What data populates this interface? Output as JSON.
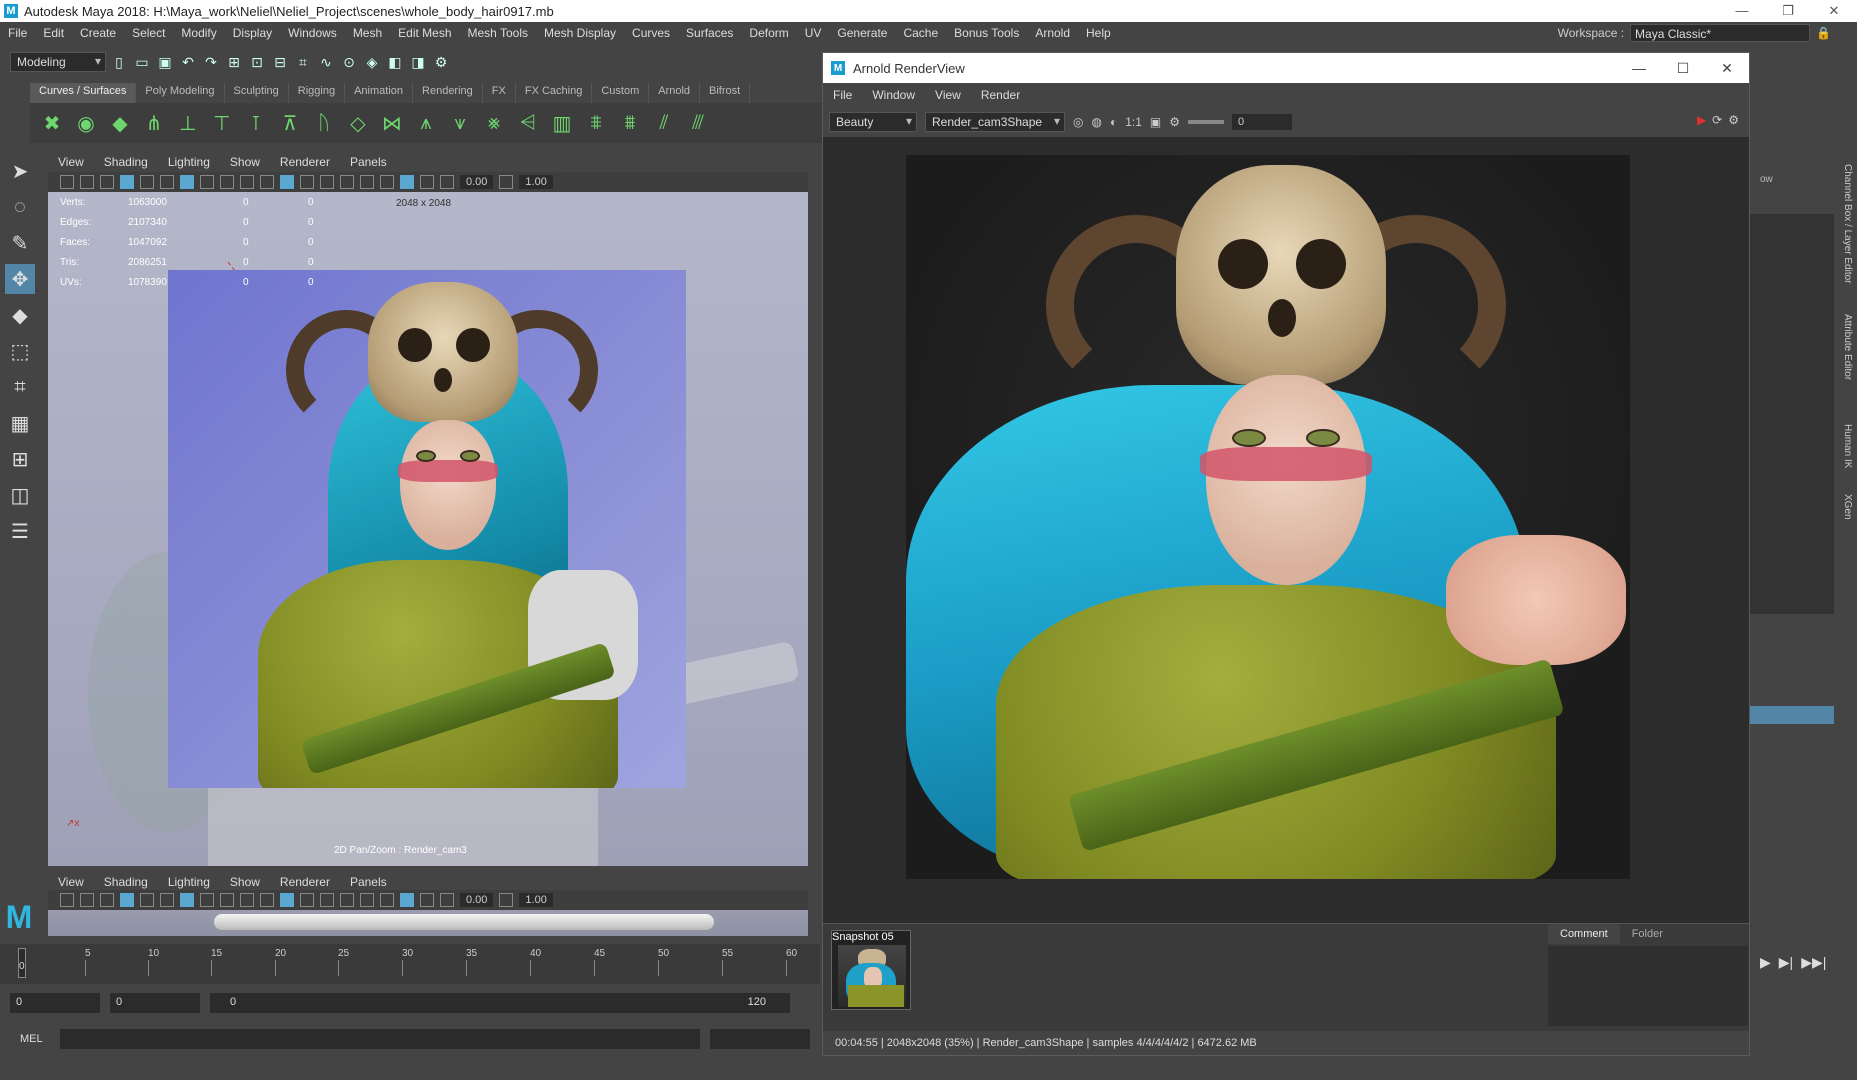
{
  "window": {
    "title": "Autodesk Maya 2018: H:\\Maya_work\\Neliel\\Neliel_Project\\scenes\\whole_body_hair0917.mb",
    "logo": "M"
  },
  "menubar": [
    "File",
    "Edit",
    "Create",
    "Select",
    "Modify",
    "Display",
    "Windows",
    "Mesh",
    "Edit Mesh",
    "Mesh Tools",
    "Mesh Display",
    "Curves",
    "Surfaces",
    "Deform",
    "UV",
    "Generate",
    "Cache",
    "Bonus Tools",
    "Arnold",
    "Help"
  ],
  "workspace": {
    "label": "Workspace :",
    "value": "Maya Classic*"
  },
  "statusline": {
    "mode": "Modeling"
  },
  "shelf_tabs": [
    "Curves / Surfaces",
    "Poly Modeling",
    "Sculpting",
    "Rigging",
    "Animation",
    "Rendering",
    "FX",
    "FX Caching",
    "Custom",
    "Arnold",
    "Bifrost"
  ],
  "viewport": {
    "menu": [
      "View",
      "Shading",
      "Lighting",
      "Show",
      "Renderer",
      "Panels"
    ],
    "fields": {
      "a": "0.00",
      "b": "1.00"
    },
    "stats": [
      {
        "label": "Verts:",
        "value": "1063000",
        "sel": "0",
        "tri": "0"
      },
      {
        "label": "Edges:",
        "value": "2107340",
        "sel": "0",
        "tri": "0"
      },
      {
        "label": "Faces:",
        "value": "1047092",
        "sel": "0",
        "tri": "0"
      },
      {
        "label": "Tris:",
        "value": "2086251",
        "sel": "0",
        "tri": "0"
      },
      {
        "label": "UVs:",
        "value": "1078390",
        "sel": "0",
        "tri": "0"
      }
    ],
    "resolution": "2048 x 2048",
    "camera_label": "2D Pan/Zoom : Render_cam3"
  },
  "viewport2": {
    "menu": [
      "View",
      "Shading",
      "Lighting",
      "Show",
      "Renderer",
      "Panels"
    ],
    "fields": {
      "a": "0.00",
      "b": "1.00"
    }
  },
  "timeline": {
    "ticks": [
      "5",
      "10",
      "15",
      "20",
      "25",
      "30",
      "35",
      "40",
      "45",
      "50",
      "55",
      "60"
    ],
    "current": "0",
    "range_start": "0",
    "anim_start": "0",
    "range_slider_start": "0",
    "range_slider_end": "120"
  },
  "cmdline": {
    "label": "MEL"
  },
  "arnold": {
    "title": "Arnold RenderView",
    "menu": [
      "File",
      "Window",
      "View",
      "Render"
    ],
    "aov": "Beauty",
    "camera": "Render_cam3Shape",
    "ratio": "1:1",
    "exposure": "0",
    "snapshot_label": "Snapshot 05",
    "tabs": [
      "Comment",
      "Folder"
    ],
    "status": "00:04:55 | 2048x2048 (35%) | Render_cam3Shape | samples 4/4/4/4/4/2 | 6472.62 MB"
  },
  "rightside": {
    "tabs": [
      "Channel Box / Layer Editor",
      "Attribute Editor",
      "Human IK",
      "XGen"
    ],
    "ow": "ow"
  }
}
